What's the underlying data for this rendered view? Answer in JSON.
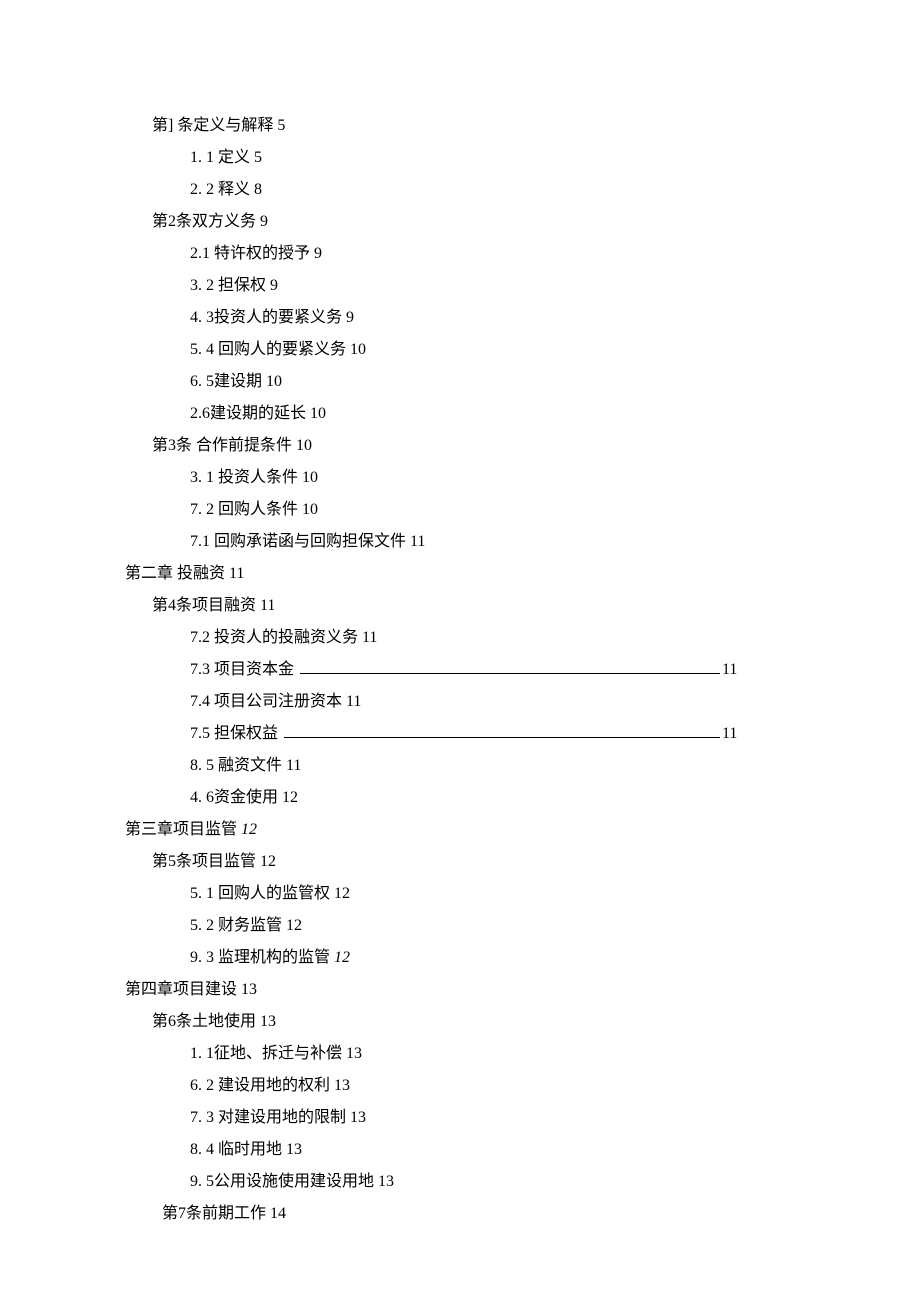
{
  "toc": {
    "items": [
      {
        "indent": "l1",
        "type": "plain",
        "text": "第] 条定义与解释 5"
      },
      {
        "indent": "l2",
        "type": "plain",
        "text": "1. 1 定义 5"
      },
      {
        "indent": "l2",
        "type": "plain",
        "text": "2. 2 释义 8"
      },
      {
        "indent": "l1",
        "type": "plain",
        "text": "第2条双方义务 9"
      },
      {
        "indent": "l2",
        "type": "plain",
        "text": "2.1  特许权的授予 9"
      },
      {
        "indent": "l2",
        "type": "plain",
        "text": "3. 2 担保权 9"
      },
      {
        "indent": "l2",
        "type": "plain",
        "text": "4. 3投资人的要紧义务 9"
      },
      {
        "indent": "l2",
        "type": "plain",
        "text": "5. 4 回购人的要紧义务 10"
      },
      {
        "indent": "l2",
        "type": "plain",
        "text": "6. 5建设期 10"
      },
      {
        "indent": "l2",
        "type": "plain",
        "text": "2.6建设期的延长 10"
      },
      {
        "indent": "l1",
        "type": "plain",
        "text": "第3条 合作前提条件 10"
      },
      {
        "indent": "l2",
        "type": "plain",
        "text": "3. 1 投资人条件 10"
      },
      {
        "indent": "l2",
        "type": "plain",
        "text": "7. 2 回购人条件 10"
      },
      {
        "indent": "l2",
        "type": "plain",
        "text": "7.1  回购承诺函与回购担保文件 11"
      },
      {
        "indent": "l3",
        "type": "plain",
        "text": "第二章 投融资 11"
      },
      {
        "indent": "l1",
        "type": "plain",
        "text": "第4条项目融资 11"
      },
      {
        "indent": "l2",
        "type": "plain",
        "text": "7.2  投资人的投融资义务 11"
      },
      {
        "indent": "l2",
        "type": "fill",
        "label": "7.3  项目资本金 ",
        "page": "11",
        "fill": 420
      },
      {
        "indent": "l2",
        "type": "plain",
        "text": "7.4  项目公司注册资本 11"
      },
      {
        "indent": "l2",
        "type": "fill",
        "label": "7.5  担保权益 ",
        "page": "11",
        "fill": 436
      },
      {
        "indent": "l2",
        "type": "plain",
        "text": "8. 5 融资文件 11"
      },
      {
        "indent": "l2",
        "type": "plain",
        "text": "4. 6资金使用 12"
      },
      {
        "indent": "l3",
        "type": "mixed",
        "text": "第三章项目监管 ",
        "italic": "12"
      },
      {
        "indent": "l1",
        "type": "plain",
        "text": "第5条项目监管 12"
      },
      {
        "indent": "l2",
        "type": "plain",
        "text": "5. 1 回购人的监管权 12"
      },
      {
        "indent": "l2",
        "type": "plain",
        "text": "5. 2 财务监管 12"
      },
      {
        "indent": "l2",
        "type": "mixed",
        "text": "9. 3 监理机构的监管 ",
        "italic": "12"
      },
      {
        "indent": "l3",
        "type": "plain",
        "text": "第四章项目建设 13"
      },
      {
        "indent": "l1",
        "type": "plain",
        "text": "第6条土地使用 13"
      },
      {
        "indent": "l2",
        "type": "plain",
        "text": "1. 1征地、拆迁与补偿 13"
      },
      {
        "indent": "l2",
        "type": "plain",
        "text": "6. 2 建设用地的权利 13"
      },
      {
        "indent": "l2",
        "type": "plain",
        "text": "7. 3  对建设用地的限制 13"
      },
      {
        "indent": "l2",
        "type": "plain",
        "text": "8. 4  临时用地 13"
      },
      {
        "indent": "l2",
        "type": "plain",
        "text": "9. 5公用设施使用建设用地 13"
      },
      {
        "indent": "l4",
        "type": "plain",
        "text": "第7条前期工作 14"
      }
    ]
  }
}
